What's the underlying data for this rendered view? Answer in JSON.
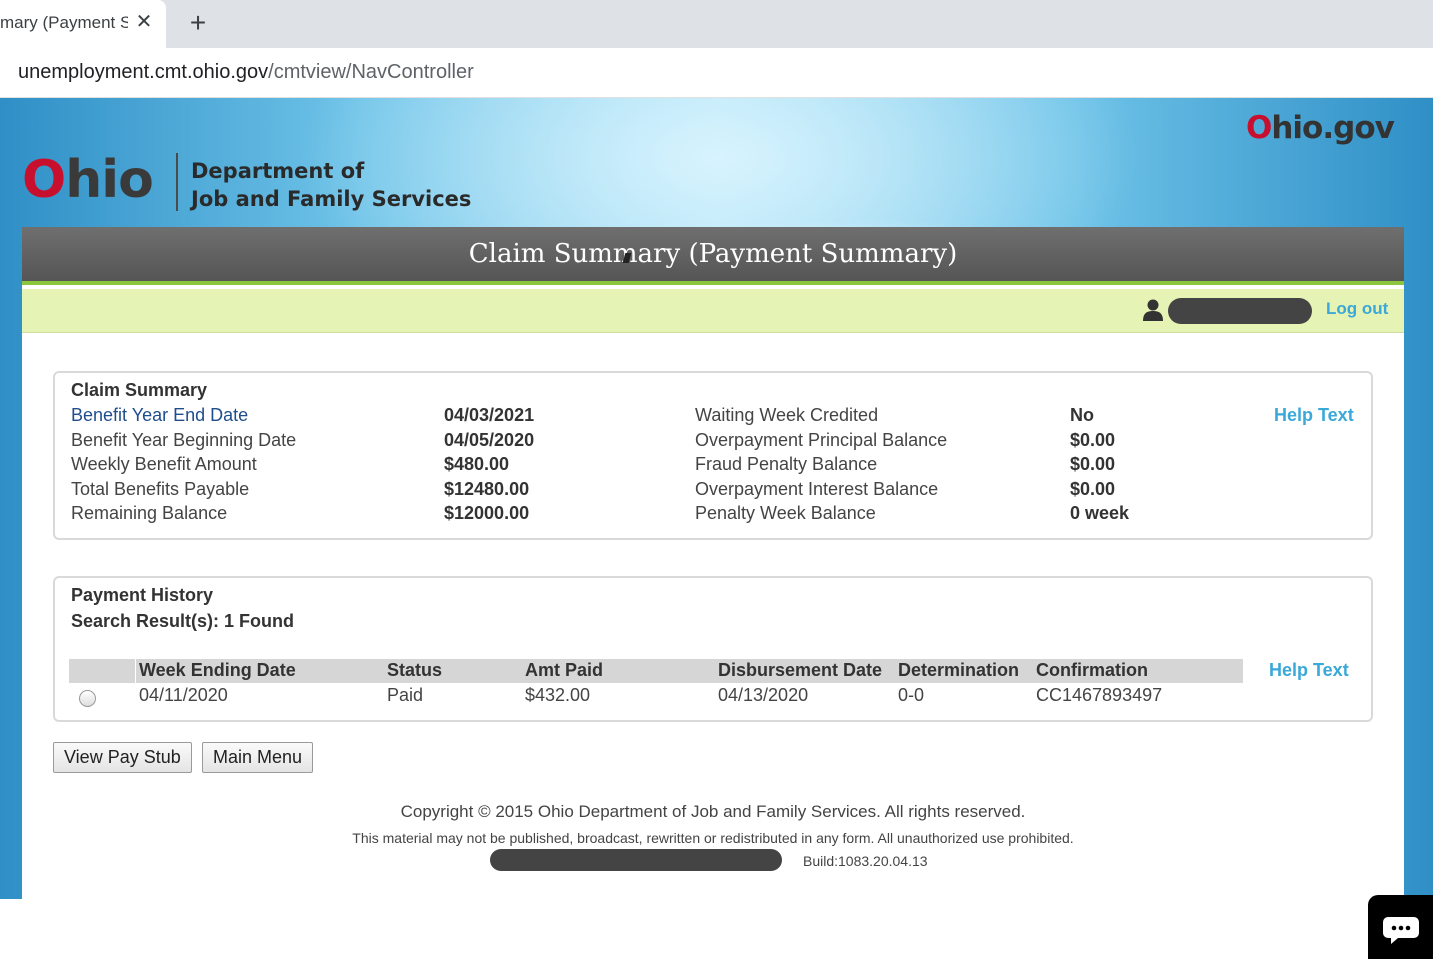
{
  "browser": {
    "tab_title": "mary (Payment S",
    "tab_close": "✕",
    "new_tab": "+",
    "url_host": "unemployment.cmt.ohio.gov",
    "url_path": "/cmtview/NavController"
  },
  "header": {
    "ohio_logo_o": "O",
    "ohio_logo_rest": "hio",
    "agency_line1": "Department of",
    "agency_line2": "Job and Family Services",
    "ohiogov_o": "O",
    "ohiogov_rest": "hio.gov"
  },
  "page_title": "Claim Summary (Payment Summary)",
  "user_bar": {
    "logout_label": "Log out"
  },
  "claim_summary": {
    "heading": "Claim Summary",
    "help_label": "Help Text",
    "left": [
      {
        "label": "Benefit Year End Date",
        "value": "04/03/2021"
      },
      {
        "label": "Benefit Year Beginning Date",
        "value": "04/05/2020"
      },
      {
        "label": "Weekly Benefit Amount",
        "value": "$480.00"
      },
      {
        "label": "Total Benefits Payable",
        "value": "$12480.00"
      },
      {
        "label": "Remaining Balance",
        "value": "$12000.00"
      }
    ],
    "right": [
      {
        "label": "Waiting Week Credited",
        "value": "No"
      },
      {
        "label": "Overpayment Principal Balance",
        "value": "$0.00"
      },
      {
        "label": "Fraud Penalty Balance",
        "value": "$0.00"
      },
      {
        "label": "Overpayment Interest Balance",
        "value": "$0.00"
      },
      {
        "label": "Penalty Week Balance",
        "value": "0 week"
      }
    ]
  },
  "payment_history": {
    "heading": "Payment History",
    "search_results": "Search Result(s): 1 Found",
    "help_label": "Help Text",
    "columns": [
      "Week Ending Date",
      "Status",
      "Amt Paid",
      "Disbursement Date",
      "Determination",
      "Confirmation"
    ],
    "rows": [
      [
        "04/11/2020",
        "Paid",
        "$432.00",
        "04/13/2020",
        "0-0",
        "CC1467893497"
      ]
    ]
  },
  "buttons": {
    "view_pay_stub": "View Pay Stub",
    "main_menu": "Main Menu"
  },
  "footer": {
    "copyright": "Copyright © 2015 Ohio Department of Job and Family Services. All rights reserved.",
    "disclaimer": "This material may not be published, broadcast, rewritten or redistributed in any form. All unauthorized use prohibited.",
    "build": "Build:1083.20.04.13"
  },
  "colors": {
    "accent_green": "#8cc63f",
    "user_bar_bg": "#e5f3b4",
    "link_blue": "#3aa8d8",
    "ohio_red": "#c8102e"
  },
  "icons": [
    "close-icon",
    "plus-icon",
    "user-icon",
    "chat-icon"
  ]
}
